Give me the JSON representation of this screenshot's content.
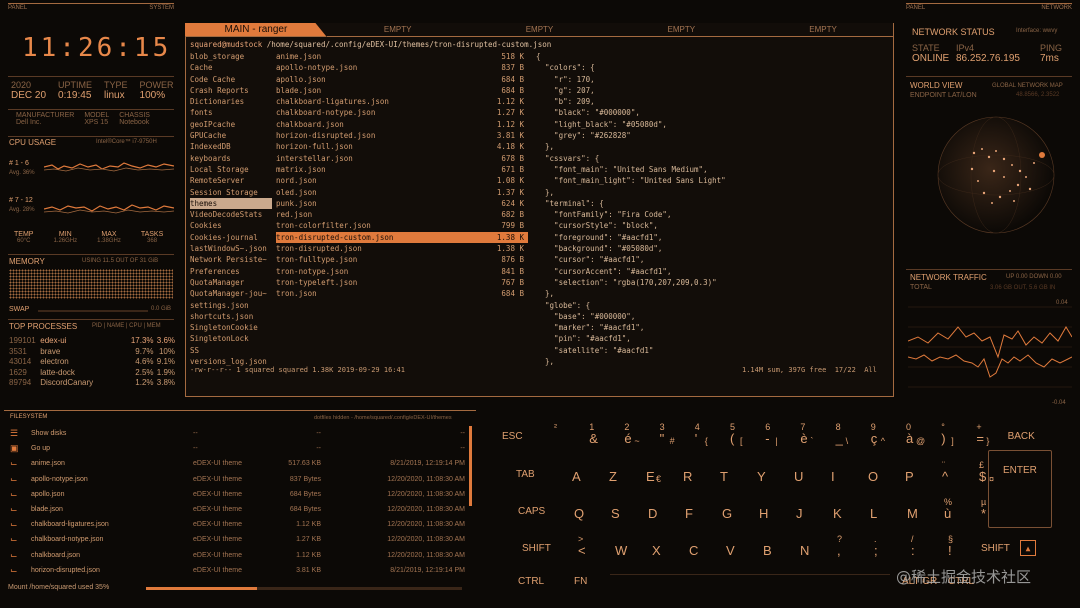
{
  "left": {
    "panel_label": "PANEL",
    "system_label": "SYSTEM",
    "clock": "11:26:15",
    "date": {
      "year": "2020",
      "day": "DEC 20",
      "uptime_label": "UPTIME",
      "uptime": "0:19:45",
      "type_label": "TYPE",
      "type": "linux",
      "power_label": "POWER",
      "power": "100%"
    },
    "hw": {
      "manufacturer_label": "MANUFACTURER",
      "manufacturer": "Dell Inc.",
      "model_label": "MODEL",
      "model": "XPS 15",
      "chassis_label": "CHASSIS",
      "chassis": "Notebook"
    },
    "cpu": {
      "title": "CPU USAGE",
      "model": "Intel®Core™ i7-9750H",
      "g1_label": "# 1 - 6",
      "g1_avg": "Avg. 36%",
      "g2_label": "# 7 - 12",
      "g2_avg": "Avg. 28%",
      "temp_label": "TEMP",
      "temp": "60°C",
      "min_label": "MIN",
      "min": "1.26GHz",
      "max_label": "MAX",
      "max": "1.38GHz",
      "tasks_label": "TASKS",
      "tasks": "368"
    },
    "memory": {
      "title": "MEMORY",
      "usage": "USING 11.5 OUT OF 31 GiB",
      "swap_label": "SWAP",
      "swap": "0.0 GiB"
    },
    "processes": {
      "title": "TOP PROCESSES",
      "cols": "PID | NAME | CPU | MEM",
      "rows": [
        {
          "pid": "199101",
          "name": "edex-ui",
          "cpu": "17.3%",
          "mem": "3.6%"
        },
        {
          "pid": "3531",
          "name": "brave",
          "cpu": "9.7%",
          "mem": "10%"
        },
        {
          "pid": "43014",
          "name": "electron",
          "cpu": "4.6%",
          "mem": "9.1%"
        },
        {
          "pid": "1629",
          "name": "latte-dock",
          "cpu": "2.5%",
          "mem": "1.9%"
        },
        {
          "pid": "89794",
          "name": "DiscordCanary",
          "cpu": "1.2%",
          "mem": "3.8%"
        }
      ]
    }
  },
  "terminal": {
    "tabs": [
      "MAIN - ranger",
      "EMPTY",
      "EMPTY",
      "EMPTY",
      "EMPTY"
    ],
    "path_user": "squared@mudstock",
    "path": "/home/squared/.config/eDEX-UI/themes/tron-disrupted-custom.json",
    "dirs": [
      "blob_storage",
      "Cache",
      "Code Cache",
      "Crash Reports",
      "Dictionaries",
      "fonts",
      "geoIPcache",
      "GPUCache",
      "IndexedDB",
      "keyboards",
      "Local Storage",
      "RemoteServer",
      "Session Storage",
      "themes",
      "VideoDecodeStats",
      "Cookies",
      "Cookies-journal",
      "lastWindowS~.json",
      "Network Persiste~",
      "Preferences",
      "QuotaManager",
      "QuotaManager-jou~",
      "settings.json",
      "shortcuts.json",
      "SingletonCookie",
      "SingletonLock",
      "SS",
      "versions_log.json"
    ],
    "files": [
      {
        "n": "anime.json",
        "s": "518 K"
      },
      {
        "n": "apollo-notype.json",
        "s": "837 B"
      },
      {
        "n": "apollo.json",
        "s": "684 B"
      },
      {
        "n": "blade.json",
        "s": "684 B"
      },
      {
        "n": "chalkboard-ligatures.json",
        "s": "1.12 K"
      },
      {
        "n": "chalkboard-notype.json",
        "s": "1.27 K"
      },
      {
        "n": "chalkboard.json",
        "s": "1.12 K"
      },
      {
        "n": "horizon-disrupted.json",
        "s": "3.81 K"
      },
      {
        "n": "horizon-full.json",
        "s": "4.18 K"
      },
      {
        "n": "interstellar.json",
        "s": "678 B"
      },
      {
        "n": "matrix.json",
        "s": "671 B"
      },
      {
        "n": "nord.json",
        "s": "1.08 K"
      },
      {
        "n": "oled.json",
        "s": "1.37 K"
      },
      {
        "n": "punk.json",
        "s": "624 K"
      },
      {
        "n": "red.json",
        "s": "682 B"
      },
      {
        "n": "tron-colorfilter.json",
        "s": "799 B"
      },
      {
        "n": "tron-disrupted-custom.json",
        "s": "1.38 K"
      },
      {
        "n": "tron-disrupted.json",
        "s": "1.38 K"
      },
      {
        "n": "tron-fulltype.json",
        "s": "876 B"
      },
      {
        "n": "tron-notype.json",
        "s": "841 B"
      },
      {
        "n": "tron-typeleft.json",
        "s": "767 B"
      },
      {
        "n": "tron.json",
        "s": "684 B"
      }
    ],
    "json_lines": [
      "{",
      "  \"colors\": {",
      "    \"r\": 170,",
      "    \"g\": 207,",
      "    \"b\": 209,",
      "    \"black\": \"#000000\",",
      "    \"light_black\": \"#05080d\",",
      "    \"grey\": \"#262828\"",
      "  },",
      "  \"cssvars\": {",
      "    \"font_main\": \"United Sans Medium\",",
      "    \"font_main_light\": \"United Sans Light\"",
      "  },",
      "  \"terminal\": {",
      "    \"fontFamily\": \"Fira Code\",",
      "    \"cursorStyle\": \"block\",",
      "    \"foreground\": \"#aacfd1\",",
      "    \"background\": \"#05080d\",",
      "    \"cursor\": \"#aacfd1\",",
      "    \"cursorAccent\": \"#aacfd1\",",
      "    \"selection\": \"rgba(170,207,209,0.3)\"",
      "  },",
      "  \"globe\": {",
      "    \"base\": \"#000000\",",
      "    \"marker\": \"#aacfd1\",",
      "    \"pin\": \"#aacfd1\",",
      "    \"satellite\": \"#aacfd1\"",
      "  },"
    ],
    "status_left": "-rw-r--r-- 1 squared squared 1.38K 2019-09-29 16:41",
    "status_right": "1.14M sum, 397G free  17/22  All"
  },
  "right": {
    "panel_label": "PANEL",
    "network_label": "NETWORK",
    "status_title": "NETWORK STATUS",
    "iface": "Interface: wwvy",
    "state_label": "STATE",
    "state": "ONLINE",
    "ip_label": "IPv4",
    "ip": "86.252.76.195",
    "ping_label": "PING",
    "ping": "7ms",
    "world_title": "WORLD VIEW",
    "world_sub": "GLOBAL NETWORK MAP",
    "endpoint": "ENDPOINT LAT/LON",
    "coords": "48.8566, 2.3522",
    "traffic_title": "NETWORK TRAFFIC",
    "traffic_sub": "UP 0.00 DOWN 0.00",
    "total_label": "TOTAL",
    "total": "3.06 GB OUT, 5.6 GB IN",
    "scale_top": "0.04",
    "scale_bottom": "-0.04"
  },
  "filesystem": {
    "title": "FILESYSTEM",
    "hint": "dotfiles hidden - /home/squared/.config/eDEX-UI/themes",
    "rows": [
      {
        "name": "Show disks",
        "type": "--",
        "size": "--",
        "date": "--"
      },
      {
        "name": "Go up",
        "type": "--",
        "size": "--",
        "date": "--"
      },
      {
        "name": "anime.json",
        "type": "eDEX-UI theme",
        "size": "517.63 KB",
        "date": "8/21/2019, 12:19:14 PM"
      },
      {
        "name": "apollo-notype.json",
        "type": "eDEX-UI theme",
        "size": "837 Bytes",
        "date": "12/20/2020, 11:08:30 AM"
      },
      {
        "name": "apollo.json",
        "type": "eDEX-UI theme",
        "size": "684 Bytes",
        "date": "12/20/2020, 11:08:30 AM"
      },
      {
        "name": "blade.json",
        "type": "eDEX-UI theme",
        "size": "684 Bytes",
        "date": "12/20/2020, 11:08:30 AM"
      },
      {
        "name": "chalkboard-ligatures.json",
        "type": "eDEX-UI theme",
        "size": "1.12 KB",
        "date": "12/20/2020, 11:08:30 AM"
      },
      {
        "name": "chalkboard-notype.json",
        "type": "eDEX-UI theme",
        "size": "1.27 KB",
        "date": "12/20/2020, 11:08:30 AM"
      },
      {
        "name": "chalkboard.json",
        "type": "eDEX-UI theme",
        "size": "1.12 KB",
        "date": "12/20/2020, 11:08:30 AM"
      },
      {
        "name": "horizon-disrupted.json",
        "type": "eDEX-UI theme",
        "size": "3.81 KB",
        "date": "8/21/2019, 12:19:14 PM"
      }
    ],
    "mount": "Mount /home/squared used 35%",
    "used_fraction": 0.35
  },
  "keyboard": {
    "row1": [
      {
        "m": "ESC"
      },
      {
        "t": "²",
        "m": ""
      },
      {
        "t": "1",
        "m": "&"
      },
      {
        "t": "2",
        "m": "é",
        "s": "~"
      },
      {
        "t": "3",
        "m": "\"",
        "s": "#"
      },
      {
        "t": "4",
        "m": "'",
        "s": "{"
      },
      {
        "t": "5",
        "m": "(",
        "s": "["
      },
      {
        "t": "6",
        "m": "-",
        "s": "|"
      },
      {
        "t": "7",
        "m": "è",
        "s": "`"
      },
      {
        "t": "8",
        "m": "_",
        "s": "\\"
      },
      {
        "t": "9",
        "m": "ç",
        "s": "^"
      },
      {
        "t": "0",
        "m": "à",
        "s": "@"
      },
      {
        "t": "°",
        "m": ")",
        "s": "]"
      },
      {
        "t": "+",
        "m": "=",
        "s": "}"
      },
      {
        "m": "BACK"
      }
    ],
    "row2": [
      {
        "m": "TAB"
      },
      {
        "m": "A"
      },
      {
        "m": "Z"
      },
      {
        "m": "E",
        "s": "€"
      },
      {
        "m": "R"
      },
      {
        "m": "T"
      },
      {
        "m": "Y"
      },
      {
        "m": "U"
      },
      {
        "m": "I"
      },
      {
        "m": "O"
      },
      {
        "m": "P"
      },
      {
        "t": "¨",
        "m": "^"
      },
      {
        "t": "£",
        "m": "$",
        "s": "¤"
      }
    ],
    "row3": [
      {
        "m": "CAPS"
      },
      {
        "m": "Q"
      },
      {
        "m": "S"
      },
      {
        "m": "D"
      },
      {
        "m": "F"
      },
      {
        "m": "G"
      },
      {
        "m": "H"
      },
      {
        "m": "J"
      },
      {
        "m": "K"
      },
      {
        "m": "L"
      },
      {
        "m": "M"
      },
      {
        "t": "%",
        "m": "ù"
      },
      {
        "t": "µ",
        "m": "*"
      }
    ],
    "row4": [
      {
        "m": "SHIFT"
      },
      {
        "t": ">",
        "m": "<"
      },
      {
        "m": "W"
      },
      {
        "m": "X"
      },
      {
        "m": "C"
      },
      {
        "m": "V"
      },
      {
        "m": "B"
      },
      {
        "m": "N"
      },
      {
        "t": "?",
        "m": ","
      },
      {
        "t": ".",
        "m": ";"
      },
      {
        "t": "/",
        "m": ":"
      },
      {
        "t": "§",
        "m": "!"
      },
      {
        "m": "SHIFT"
      }
    ],
    "row5": [
      {
        "m": "CTRL"
      },
      {
        "m": "FN"
      },
      {
        "m": "ALT GR"
      },
      {
        "m": "CTRL"
      }
    ],
    "enter": "ENTER"
  },
  "watermark": "@稀土掘金技术社区"
}
